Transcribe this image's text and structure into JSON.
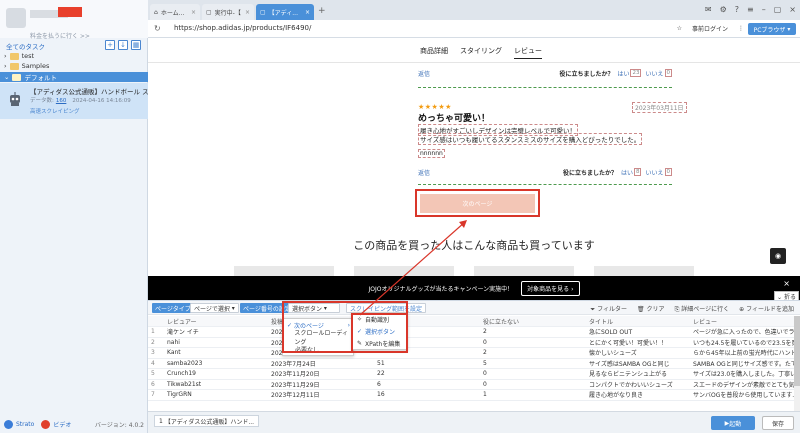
{
  "sidebar": {
    "plan_link": "料金を払うに行く >>",
    "all_tasks": "全てのタスク",
    "folders": [
      "test",
      "Samples"
    ],
    "default_group": "デフォルト",
    "task": {
      "title": "【アディダス公式通販】ハンドボール スペ...",
      "count_label": "データ数:",
      "count": "160",
      "timestamp": "2024-04-16 14:16:09",
      "mode": "高速スクレイピング"
    },
    "footer": {
      "strato": "Strato",
      "video": "ビデオ",
      "version": "バージョン: 4.0.2"
    }
  },
  "browser": {
    "tabs": [
      {
        "label": "ホーム...",
        "active": false
      },
      {
        "label": "実行中-【",
        "active": false
      },
      {
        "label": "【アディ...",
        "active": true
      }
    ],
    "url": "https://shop.adidas.jp/products/IF6490/",
    "login_label": "事前ログイン",
    "pc_browser": "PCブラウザ"
  },
  "page": {
    "tabs": [
      "商品詳細",
      "スタイリング",
      "レビュー"
    ],
    "reply": "返信",
    "helpful": "役に立ちましたか？",
    "yes": "はい",
    "no": "いいえ",
    "review1_counts": [
      "23",
      "0"
    ],
    "review2": {
      "stars": "★★★★★",
      "date": "2023年03月11日",
      "title": "めっちゃ可愛い！",
      "line1": "履き心地がすごいしデザインは完璧レベルで可愛い！",
      "line2": "サイズ感はいつも履いてるスタンスミスのサイズを購入どぴったりでした。",
      "tail": "nnnnnn",
      "counts": [
        "8",
        "0"
      ]
    },
    "next_page": "次のページ",
    "recs_title": "この商品を買った人はこんな商品も買っています",
    "banner_text": "JOJOオリジナルグッズが当たるキャンペーン実施中！",
    "banner_btn": "対象商品を見る",
    "collapse": "折る"
  },
  "panel": {
    "page_type_label": "ページタイプ",
    "page_type_value": "ページで選択",
    "paging_label": "ページ番号の設定",
    "paging_value": "選択ボタン",
    "scroll_label": "スクレイピング範囲を設定",
    "filter": "フィルター",
    "clear": "クリア",
    "detail": "詳細ページに行く",
    "add_field": "フィールドを追加",
    "columns": [
      "",
      "レビュアー",
      "投稿日",
      "役に立つ",
      "役に立たない",
      "タイトル",
      "レビュー"
    ],
    "rows": [
      [
        "1",
        "滝ケン イチ",
        "2024年",
        "",
        "2",
        "急にSOLD OUT",
        "ページが急に入ったので、色違いでラン..."
      ],
      [
        "2",
        "nahi",
        "2024年",
        "",
        "0",
        "とにかく可愛い！可愛い！！",
        "いつも24.5を履いているので23.5を買ったら問..."
      ],
      [
        "3",
        "Kant",
        "2023年11月25日",
        "",
        "2",
        "懐かしいシューズ",
        "らから45年以上前の蛍光時代にハンドボー..."
      ],
      [
        "4",
        "samba2023",
        "2023年7月24日",
        "51",
        "5",
        "サイズ感はSAMBA OGと同じ",
        "SAMBA OGと同じサイズ感です。たてぐ..."
      ],
      [
        "5",
        "Crunch19",
        "2023年11月20日",
        "22",
        "0",
        "見るならビニテンシュ上がる",
        "サイズは23.0を購入しました。丁寧いいです..."
      ],
      [
        "6",
        "Tikwab21st",
        "2023年11月29日",
        "6",
        "0",
        "コンパクトでかわいいシューズ",
        "スエードのデザインが素敵でとても気に入..."
      ],
      [
        "7",
        "TigrGRN",
        "2023年12月11日",
        "16",
        "1",
        "履き心地がなり良き",
        "サンバOGを普段から使用しています..."
      ]
    ],
    "dropdown": [
      "次のページ",
      "スクロールローディング",
      "必要なし"
    ],
    "submenu": [
      "自動識別",
      "選択ボタン",
      "XPathを編集"
    ]
  },
  "bottom": {
    "task_tab": "【アディダス公式通販】ハンド...",
    "start": "起動",
    "save": "保存"
  }
}
